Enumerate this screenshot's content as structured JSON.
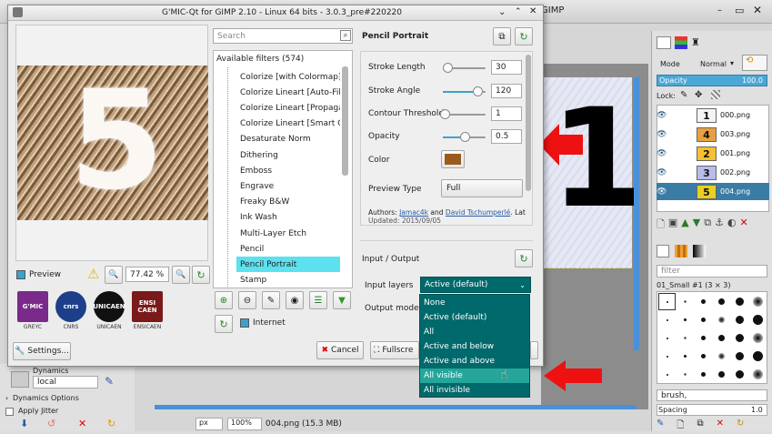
{
  "gimp": {
    "title_right": "GIMP",
    "mode_label": "Mode",
    "mode_value": "Normal",
    "opacity_label": "Opacity",
    "opacity_value": "100.0",
    "lock_label": "Lock:",
    "layers": [
      {
        "name": "000.png",
        "thumb": "1"
      },
      {
        "name": "003.png",
        "thumb": "4"
      },
      {
        "name": "001.png",
        "thumb": "2"
      },
      {
        "name": "002.png",
        "thumb": "3"
      },
      {
        "name": "004.png",
        "thumb": "5"
      }
    ],
    "brush_filter_placeholder": "filter",
    "brush_name": "01_Small #1 (3 × 3)",
    "brush_tag": "brush,",
    "spacing_label": "Spacing",
    "spacing_value": "1.0",
    "dynamics_label": "Dynamics",
    "dynamics_value": "local",
    "dynamics_options": "Dynamics Options",
    "apply_jitter": "Apply Jitter",
    "zoom_unit": "px",
    "zoom_value": "100%",
    "status": "004.png (15.3 MB)",
    "canvas_digit": "1"
  },
  "gmic": {
    "title": "G'MIC-Qt for GIMP 2.10 - Linux 64 bits - 3.0.3_pre#220220",
    "search_placeholder": "Search",
    "filters_header": "Available filters (574)",
    "filters": [
      "Colorize [with Colormap]",
      "Colorize Lineart [Auto-Fill]",
      "Colorize Lineart [Propagation]",
      "Colorize Lineart [Smart Coloring]",
      "Desaturate Norm",
      "Dithering",
      "Emboss",
      "Engrave",
      "Freaky B&W",
      "Ink Wash",
      "Multi-Layer Etch",
      "Pencil",
      "Pencil Portrait",
      "Stamp"
    ],
    "selected_filter": "Pencil Portrait",
    "filter_title": "Pencil Portrait",
    "params": {
      "stroke_length": {
        "label": "Stroke Length",
        "value": "30",
        "fraction": 0.1
      },
      "stroke_angle": {
        "label": "Stroke Angle",
        "value": "120",
        "fraction": 0.8
      },
      "contour_threshold": {
        "label": "Contour Threshold",
        "value": "1",
        "fraction": 0.05
      },
      "opacity": {
        "label": "Opacity",
        "value": "0.5",
        "fraction": 0.5
      },
      "color": {
        "label": "Color",
        "value": "#9a5a1c"
      },
      "preview_type": {
        "label": "Preview Type",
        "value": "Full"
      }
    },
    "authors_prefix": "Authors: ",
    "author1": "Jamac4k",
    "authors_and": " and ",
    "author2": "David Tschumperlé",
    "authors_tail": ".     Lat",
    "updated": "Updated: 2015/09/05",
    "io_header": "Input / Output",
    "input_layers_label": "Input layers",
    "input_layers_value": "Active (default)",
    "output_mode_label": "Output mode",
    "dropdown": [
      "None",
      "Active (default)",
      "All",
      "Active and below",
      "Active and above",
      "All visible",
      "All invisible"
    ],
    "dropdown_highlight": "All visible",
    "preview_label": "Preview",
    "zoom_value": "77.42 %",
    "internet_label": "Internet",
    "settings_label": "Settings...",
    "cancel_label": "Cancel",
    "fullscreen_label": "Fullscre",
    "preview_digit": "5",
    "logos": [
      {
        "mark": "G'MIC",
        "caption": "GREYC"
      },
      {
        "mark": "cnrs",
        "caption": "CNRS"
      },
      {
        "mark": "UNICAEN",
        "caption": "UNICAEN"
      },
      {
        "mark": "ENSI CAEN",
        "caption": "ENSICAEN"
      }
    ]
  },
  "colors": {
    "accent": "#3aa3c9",
    "highlight": "#26a69a",
    "selected_filter_bg": "#5ce1ef",
    "dropdown_bg": "#00696b",
    "arrow": "#ee1111"
  }
}
